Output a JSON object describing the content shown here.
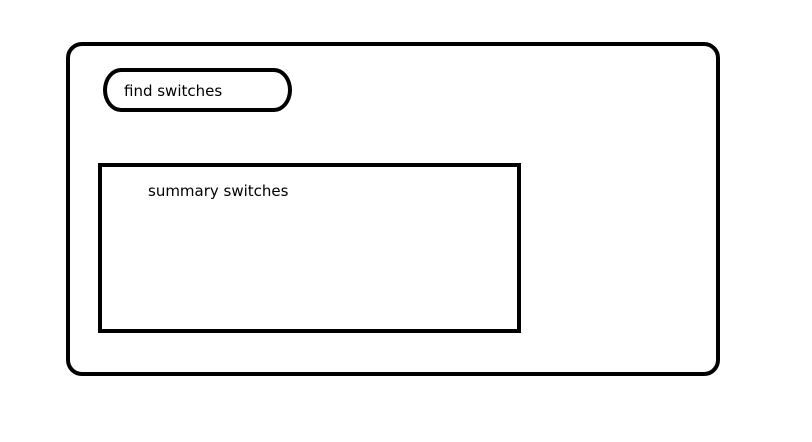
{
  "find_button": {
    "label": "find switches"
  },
  "summary_panel": {
    "title": "summary switches"
  }
}
